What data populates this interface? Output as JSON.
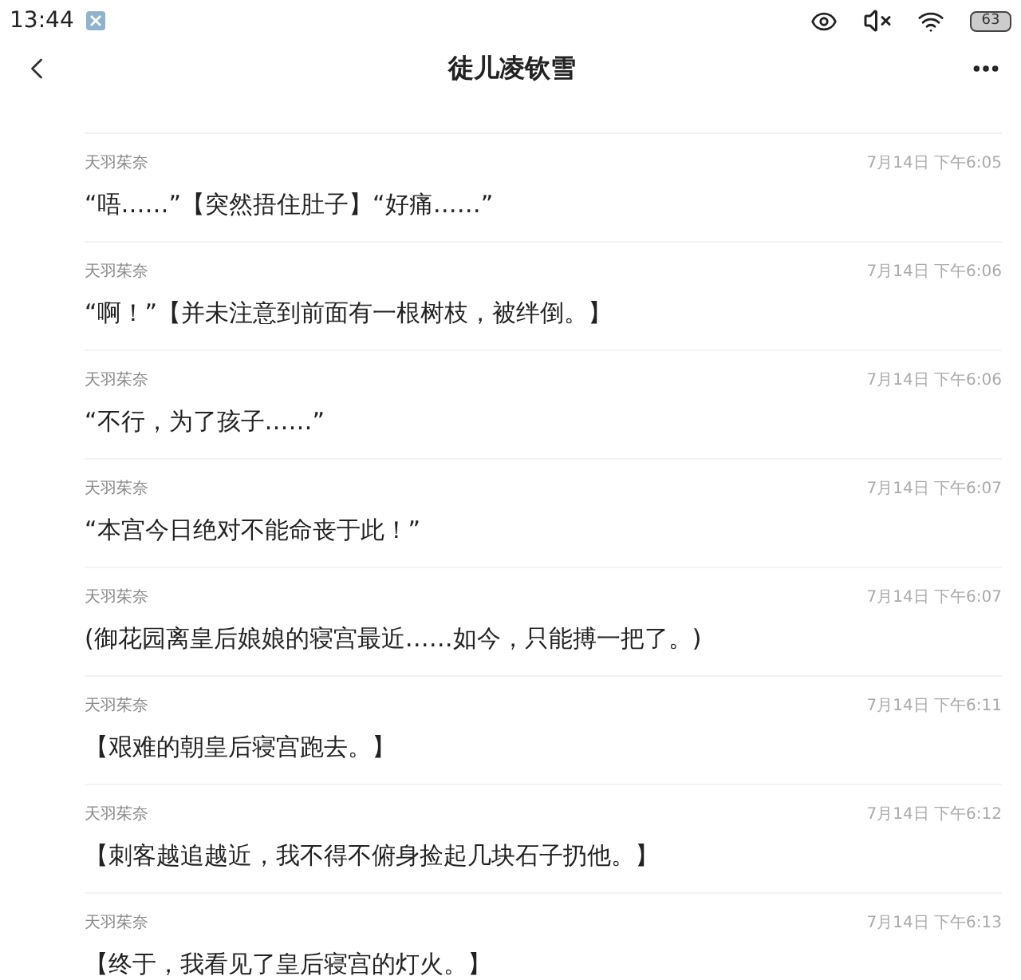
{
  "status_bar": {
    "time": "13:44",
    "battery": "63"
  },
  "header": {
    "title": "徒儿凌钦雪"
  },
  "messages": [
    {
      "author": "天羽茱奈",
      "time": "7月14日 下午6:05",
      "text": "“唔……”【突然捂住肚子】“好痛……”"
    },
    {
      "author": "天羽茱奈",
      "time": "7月14日 下午6:06",
      "text": "“啊！”【并未注意到前面有一根树枝，被绊倒。】"
    },
    {
      "author": "天羽茱奈",
      "time": "7月14日 下午6:06",
      "text": "“不行，为了孩子……”"
    },
    {
      "author": "天羽茱奈",
      "time": "7月14日 下午6:07",
      "text": "“本宫今日绝对不能命丧于此！”"
    },
    {
      "author": "天羽茱奈",
      "time": "7月14日 下午6:07",
      "text": "(御花园离皇后娘娘的寝宫最近……如今，只能搏一把了。)"
    },
    {
      "author": "天羽茱奈",
      "time": "7月14日 下午6:11",
      "text": "【艰难的朝皇后寝宫跑去。】"
    },
    {
      "author": "天羽茱奈",
      "time": "7月14日 下午6:12",
      "text": "【刺客越追越近，我不得不俯身捡起几块石子扔他。】"
    },
    {
      "author": "天羽茱奈",
      "time": "7月14日 下午6:13",
      "text": "【终于，我看见了皇后寝宫的灯火。】"
    }
  ]
}
